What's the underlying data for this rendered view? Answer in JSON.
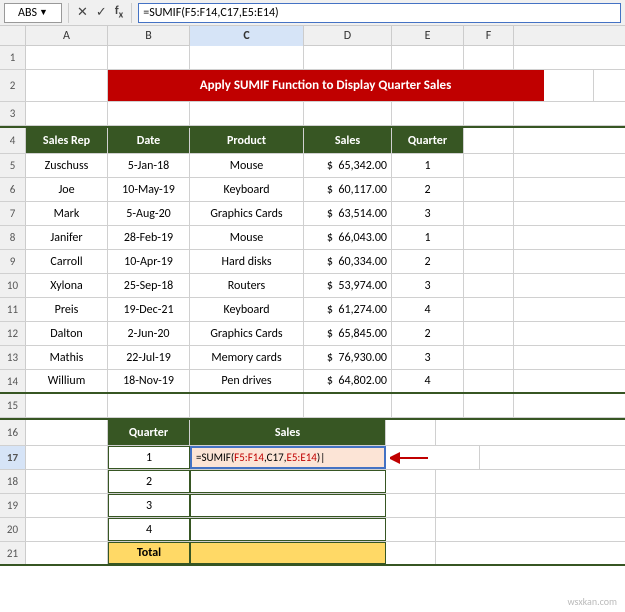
{
  "formula_bar": {
    "cell_ref": "ABS",
    "formula": "=SUMIF(F5:F14,C17,E5:E14)"
  },
  "columns": [
    "A",
    "B",
    "C",
    "D",
    "E",
    "F"
  ],
  "title": "Apply SUMIF Function to Display Quarter Sales",
  "main_table": {
    "headers": [
      "Sales Rep",
      "Date",
      "Product",
      "Sales",
      "Quarter"
    ],
    "rows": [
      {
        "num": 5,
        "sales_rep": "Zuschuss",
        "date": "5-Jan-18",
        "product": "Mouse",
        "sales": "$ 65,342.00",
        "quarter": "1"
      },
      {
        "num": 6,
        "sales_rep": "Joe",
        "date": "10-May-19",
        "product": "Keyboard",
        "sales": "$ 60,117.00",
        "quarter": "2"
      },
      {
        "num": 7,
        "sales_rep": "Mark",
        "date": "5-Aug-20",
        "product": "Graphics Cards",
        "sales": "$ 63,514.00",
        "quarter": "3"
      },
      {
        "num": 8,
        "sales_rep": "Janifer",
        "date": "28-Feb-19",
        "product": "Mouse",
        "sales": "$ 66,043.00",
        "quarter": "1"
      },
      {
        "num": 9,
        "sales_rep": "Carroll",
        "date": "10-Apr-19",
        "product": "Hard disks",
        "sales": "$ 60,334.00",
        "quarter": "2"
      },
      {
        "num": 10,
        "sales_rep": "Xylona",
        "date": "25-Sep-18",
        "product": "Routers",
        "sales": "$ 53,974.00",
        "quarter": "3"
      },
      {
        "num": 11,
        "sales_rep": "Preis",
        "date": "19-Dec-21",
        "product": "Keyboard",
        "sales": "$ 61,274.00",
        "quarter": "4"
      },
      {
        "num": 12,
        "sales_rep": "Dalton",
        "date": "2-Jun-20",
        "product": "Graphics Cards",
        "sales": "$ 65,845.00",
        "quarter": "2"
      },
      {
        "num": 13,
        "sales_rep": "Mathis",
        "date": "22-Jul-19",
        "product": "Memory cards",
        "sales": "$ 76,930.00",
        "quarter": "3"
      },
      {
        "num": 14,
        "sales_rep": "Willium",
        "date": "18-Nov-19",
        "product": "Pen drives",
        "sales": "$ 64,802.00",
        "quarter": "4"
      }
    ]
  },
  "summary_table": {
    "headers": [
      "Quarter",
      "Sales"
    ],
    "rows": [
      {
        "quarter": "1",
        "sales": "=SUMIF(F5:F14,C17,E5:E14)"
      },
      {
        "quarter": "2",
        "sales": ""
      },
      {
        "quarter": "3",
        "sales": ""
      },
      {
        "quarter": "4",
        "sales": ""
      }
    ],
    "total_label": "Total",
    "total_value": ""
  },
  "empty_rows": [
    1,
    2,
    3,
    15,
    16
  ],
  "watermark": "wsxkan.com"
}
